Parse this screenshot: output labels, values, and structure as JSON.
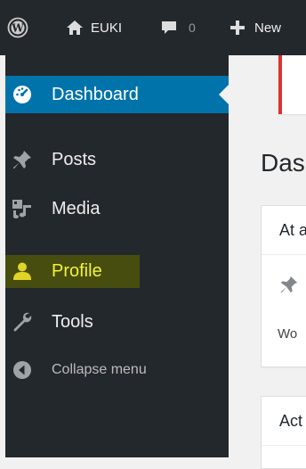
{
  "adminbar": {
    "site_name": "EUKI",
    "comments_count": "0",
    "new_label": "New"
  },
  "sidebar": {
    "items": [
      {
        "label": "Dashboard"
      },
      {
        "label": "Posts"
      },
      {
        "label": "Media"
      },
      {
        "label": "Profile"
      },
      {
        "label": "Tools"
      },
      {
        "label": "Collapse menu"
      }
    ]
  },
  "main": {
    "title": "Das",
    "widgets": [
      {
        "title": "At a",
        "body_text": "Wo"
      },
      {
        "title": "Act"
      }
    ]
  },
  "colors": {
    "adminbar_bg": "#23282d",
    "sidebar_bg": "#23282d",
    "current_item_bg": "#0073aa",
    "profile_highlight": "#f2f23a",
    "notice_border": "#dc3232",
    "content_bg": "#f1f1f1"
  }
}
